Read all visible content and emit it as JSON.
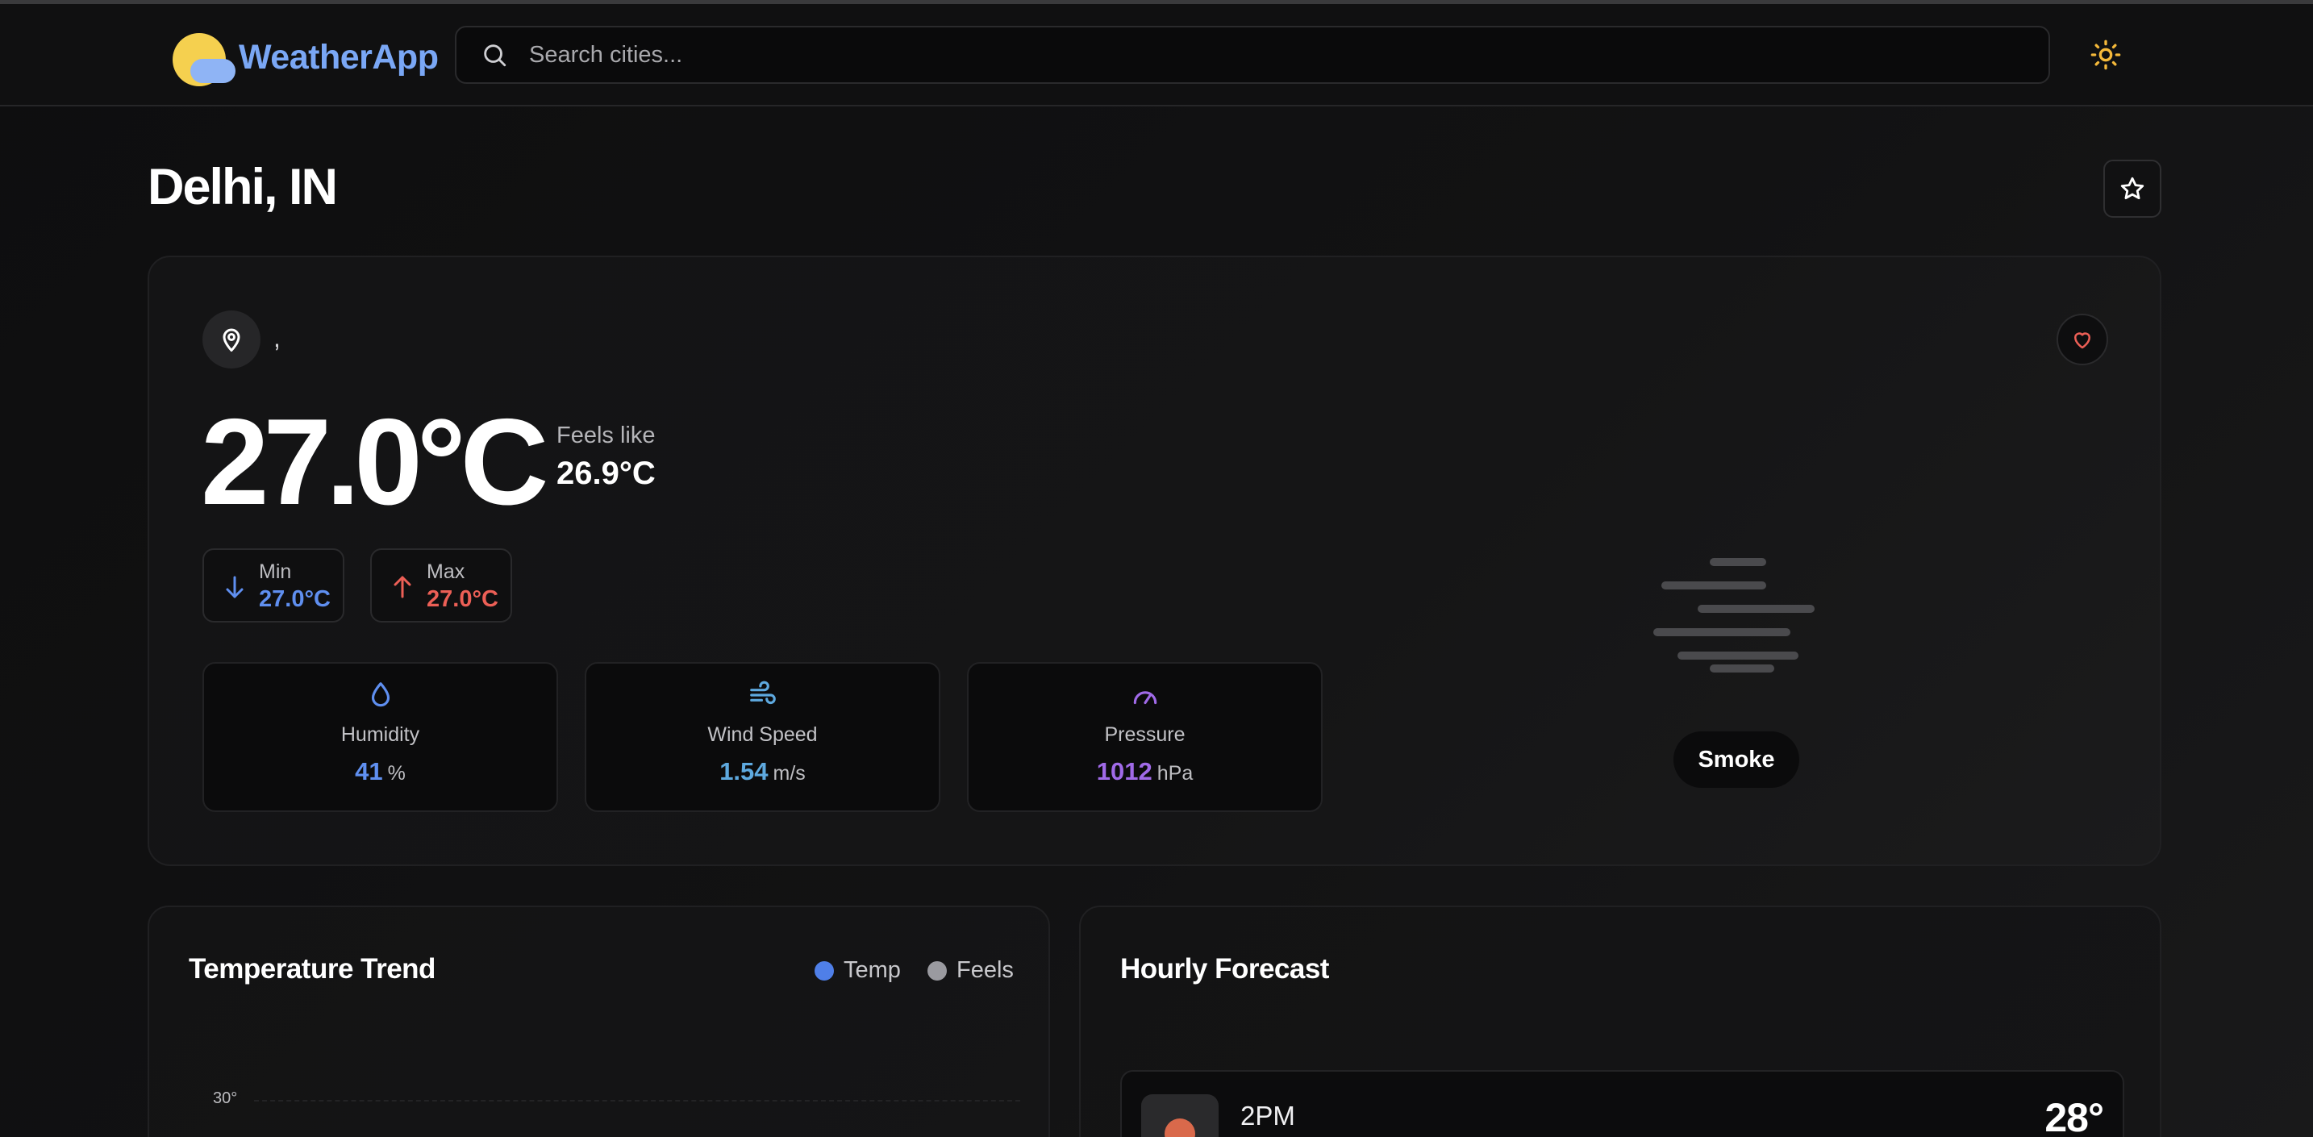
{
  "app": {
    "name": "WeatherApp"
  },
  "search": {
    "placeholder": "Search cities..."
  },
  "location": {
    "title": "Delhi, IN",
    "subtitle": ","
  },
  "current": {
    "temp": "27.0°C",
    "feels_like_label": "Feels like",
    "feels_like_value": "26.9°C",
    "min_label": "Min",
    "min_value": "27.0°C",
    "max_label": "Max",
    "max_value": "27.0°C",
    "condition": "Smoke"
  },
  "stats": [
    {
      "label": "Humidity",
      "value": "41",
      "unit": "%",
      "icon": "droplet-icon",
      "color": "#5f8ff0"
    },
    {
      "label": "Wind Speed",
      "value": "1.54",
      "unit": "m/s",
      "icon": "wind-icon",
      "color": "#5ea9df"
    },
    {
      "label": "Pressure",
      "value": "1012",
      "unit": "hPa",
      "icon": "gauge-icon",
      "color": "#a06ae8"
    }
  ],
  "trend": {
    "title": "Temperature Trend",
    "legend": [
      {
        "name": "Temp",
        "color": "#4f7fe8"
      },
      {
        "name": "Feels",
        "color": "#9a9aa0"
      }
    ],
    "y_tick": "30°"
  },
  "hourly": {
    "title": "Hourly Forecast",
    "items": [
      {
        "time": "2PM",
        "temp": "28°"
      }
    ]
  },
  "colors": {
    "accent": "#7aa7f5",
    "sun": "#f5d04f",
    "min": "#5f8ff0",
    "max": "#ec5f56",
    "favorite": "#ec5f56",
    "theme_icon": "#f5b93a"
  }
}
